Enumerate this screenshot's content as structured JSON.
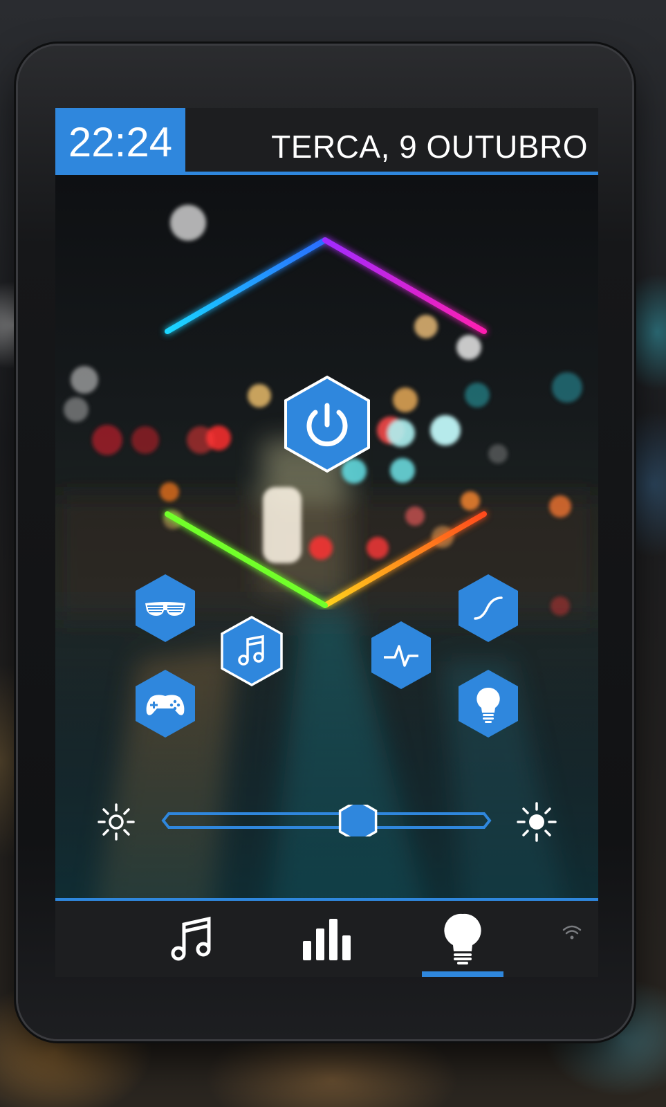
{
  "status": {
    "time": "22:24",
    "date": "TERCA, 9 OUTUBRO"
  },
  "colors": {
    "accent": "#2f87dd",
    "bar_background": "#1d1e20",
    "icon": "#ffffff"
  },
  "controls": {
    "power": {
      "icon": "power-icon",
      "selected": false
    },
    "modes": [
      {
        "icon": "party-glasses-icon"
      },
      {
        "icon": "music-note-icon",
        "selected": true
      },
      {
        "icon": "gamepad-icon"
      },
      {
        "icon": "heartbeat-icon"
      },
      {
        "icon": "curve-icon"
      },
      {
        "icon": "bulb-icon"
      }
    ]
  },
  "brightness": {
    "level": 0.6,
    "min_icon": "sun-low-icon",
    "max_icon": "sun-high-icon"
  },
  "nav": {
    "tabs": [
      {
        "icon": "music-icon",
        "active": false
      },
      {
        "icon": "equalizer-icon",
        "active": false
      },
      {
        "icon": "bulb-icon",
        "active": true
      }
    ],
    "status_icon": "wifi-icon"
  }
}
